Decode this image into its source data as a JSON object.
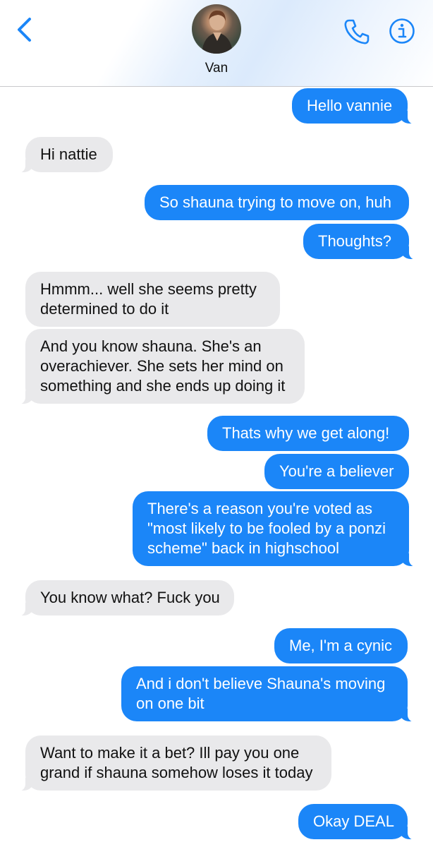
{
  "header": {
    "contact_name": "Van",
    "accent_color": "#1b86f8",
    "icons": [
      "chevron-left-icon",
      "avatar",
      "phone-icon",
      "info-icon"
    ]
  },
  "messages": [
    {
      "from": "me",
      "lines": [
        "Hello vannie"
      ]
    },
    {
      "from": "them",
      "lines": [
        "Hi nattie"
      ]
    },
    {
      "from": "me",
      "lines": [
        "So shauna trying to move on, huh"
      ]
    },
    {
      "from": "me",
      "lines": [
        "Thoughts?"
      ]
    },
    {
      "from": "them",
      "lines": [
        "Hmmm... well she seems pretty",
        "determined to do it"
      ]
    },
    {
      "from": "them",
      "lines": [
        "And you know shauna. She's an",
        "overachiever. She sets her mind on",
        "something and she ends up doing it"
      ]
    },
    {
      "from": "me",
      "lines": [
        "Thats why we get along!"
      ]
    },
    {
      "from": "me",
      "lines": [
        "You're a believer"
      ]
    },
    {
      "from": "me",
      "lines": [
        "There's a reason you're voted as",
        "\"most likely to be fooled by a ponzi",
        "scheme\" back in highschool"
      ]
    },
    {
      "from": "them",
      "lines": [
        "You know what? Fuck you"
      ]
    },
    {
      "from": "me",
      "lines": [
        "Me, I'm a cynic"
      ]
    },
    {
      "from": "me",
      "lines": [
        "And i don't believe Shauna's moving",
        "on one bit"
      ]
    },
    {
      "from": "them",
      "lines": [
        "Want to make it a bet? Ill pay you one",
        "grand if shauna somehow loses it today"
      ]
    },
    {
      "from": "me",
      "lines": [
        "Okay DEAL"
      ]
    }
  ]
}
